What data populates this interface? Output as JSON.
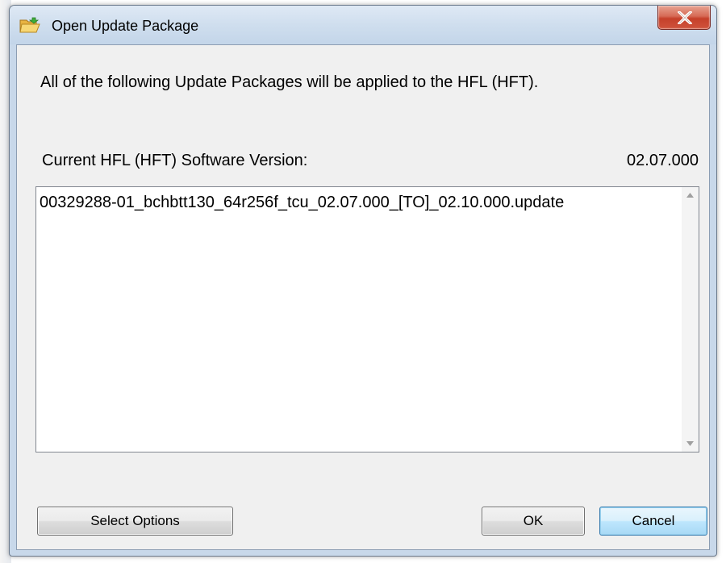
{
  "window": {
    "title": "Open Update Package",
    "close_glyph": "X",
    "icon": "folder-open-icon"
  },
  "dialog": {
    "message": "All of the following Update Packages will be applied to the HFL (HFT).",
    "version_label": "Current HFL (HFT) Software Version:",
    "version_value": "02.07.000",
    "packages": [
      "00329288-01_bchbtt130_64r256f_tcu_02.07.000_[TO]_02.10.000.update"
    ]
  },
  "buttons": {
    "select_options": "Select Options",
    "ok": "OK",
    "cancel": "Cancel"
  },
  "colors": {
    "client_bg": "#f0f0f0",
    "titlebar": "#cfdeee",
    "close_button": "#c5402a",
    "focus_button_border": "#3c7fb1"
  }
}
